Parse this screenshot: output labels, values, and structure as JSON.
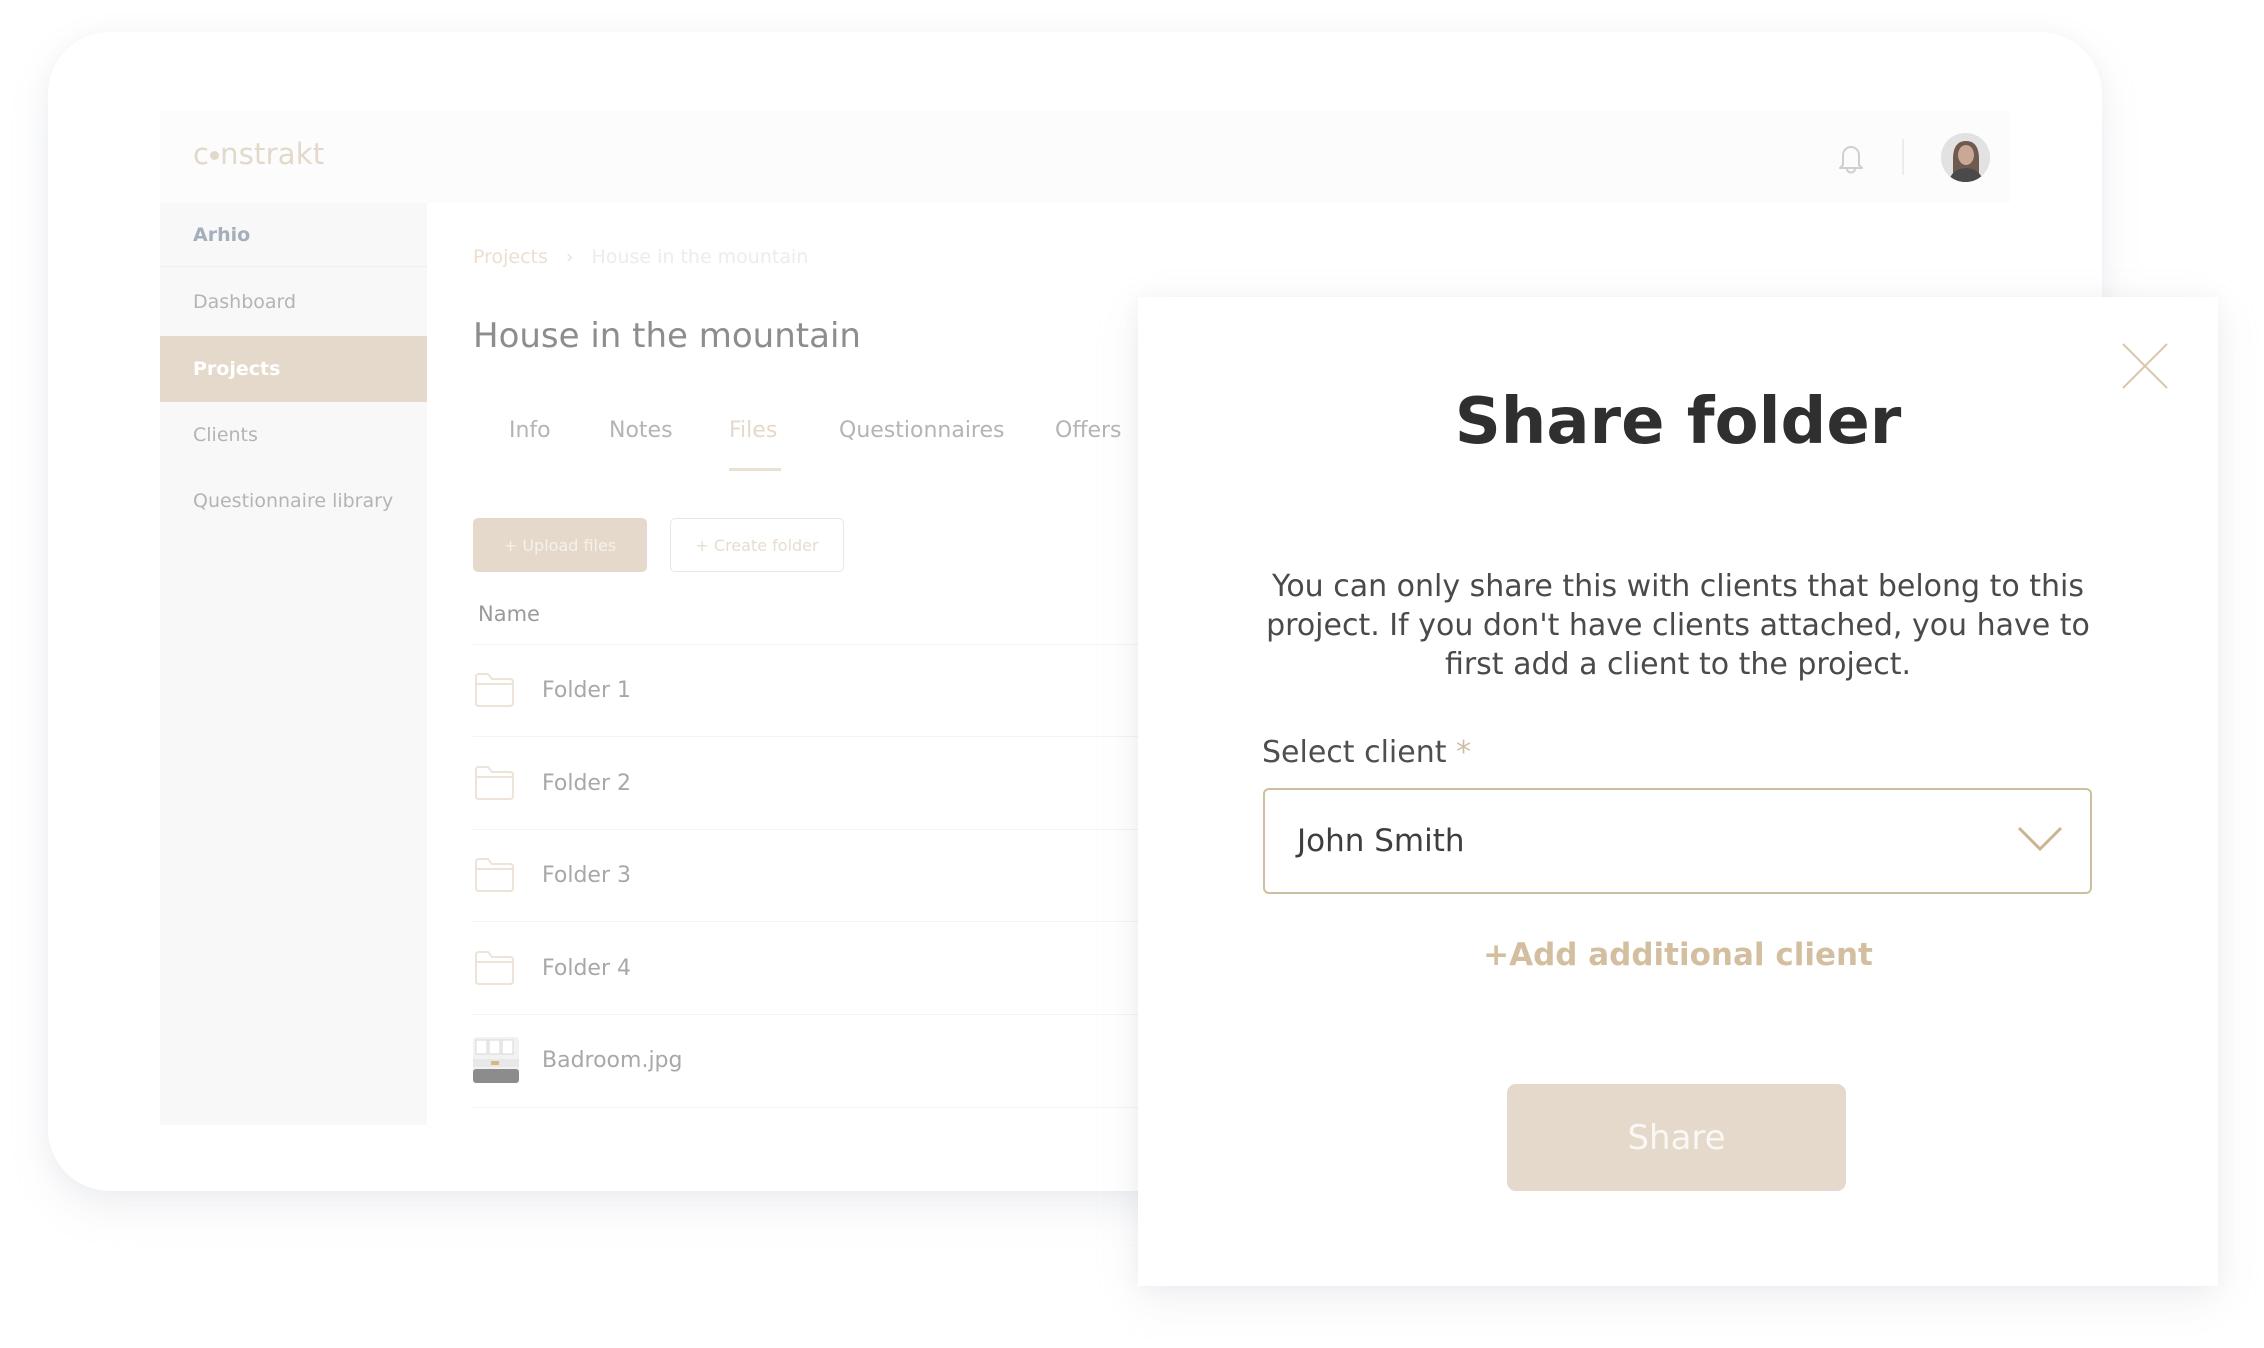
{
  "app": {
    "logo_text_left": "c",
    "logo_text_right": "nstrakt",
    "organization": "Arhio"
  },
  "header": {
    "notifications_icon": "bell-icon",
    "avatar_alt": "User avatar"
  },
  "sidebar": {
    "items": [
      {
        "label": "Dashboard",
        "active": false
      },
      {
        "label": "Projects",
        "active": true
      },
      {
        "label": "Clients",
        "active": false
      },
      {
        "label": "Questionnaire library",
        "active": false
      }
    ]
  },
  "breadcrumb": {
    "root": "Projects",
    "separator": "›",
    "current": "House in the mountain"
  },
  "page": {
    "title": "House in the mountain",
    "tabs": [
      {
        "label": "Info",
        "active": false
      },
      {
        "label": "Notes",
        "active": false
      },
      {
        "label": "Files",
        "active": true
      },
      {
        "label": "Questionnaires",
        "active": false
      },
      {
        "label": "Offers",
        "active": false
      }
    ],
    "upload_button": "+ Upload files",
    "create_folder_button": "+ Create folder",
    "column_header": "Name",
    "files": [
      {
        "name": "Folder 1",
        "type": "folder"
      },
      {
        "name": "Folder 2",
        "type": "folder"
      },
      {
        "name": "Folder 3",
        "type": "folder"
      },
      {
        "name": "Folder 4",
        "type": "folder"
      },
      {
        "name": "Badroom.jpg",
        "type": "image"
      }
    ]
  },
  "modal": {
    "title": "Share folder",
    "description": "You can only share this with clients that belong to this project. If you don't have clients attached, you have to first add a client to the project.",
    "select_label": "Select client",
    "required_marker": "*",
    "selected_client": "John Smith",
    "add_client_link": "+Add additional client",
    "share_button": "Share",
    "close_icon": "close-icon"
  },
  "colors": {
    "accent": "#e4d9ca",
    "accent_text": "#d3bf9f",
    "select_border": "#cdbf9f",
    "title": "#2f2f2f"
  }
}
